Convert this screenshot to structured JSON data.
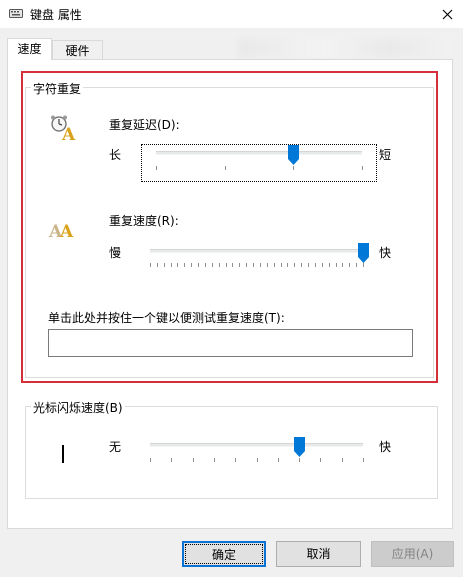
{
  "window": {
    "title": "键盘 属性",
    "close_glyph": "✕"
  },
  "tabs": [
    {
      "label": "速度",
      "active": true
    },
    {
      "label": "硬件",
      "active": false
    }
  ],
  "character_repeat": {
    "group_label": "字符重复",
    "delay": {
      "label": "重复延迟(D):",
      "min_label": "长",
      "max_label": "短",
      "value": 2,
      "min": 0,
      "max": 3
    },
    "rate": {
      "label": "重复速度(R):",
      "min_label": "慢",
      "max_label": "快",
      "value": 31,
      "min": 0,
      "max": 31
    },
    "test_label": "单击此处并按住一个键以便测试重复速度(T):",
    "test_value": ""
  },
  "cursor_blink": {
    "group_label": "光标闪烁速度(B)",
    "min_label": "无",
    "max_label": "快",
    "value": 7,
    "min": 0,
    "max": 10
  },
  "buttons": {
    "ok": "确定",
    "cancel": "取消",
    "apply": "应用(A)"
  },
  "colors": {
    "highlight_frame": "#d3303a",
    "thumb": "#0078d7",
    "default_button_border": "#0a74d4"
  }
}
